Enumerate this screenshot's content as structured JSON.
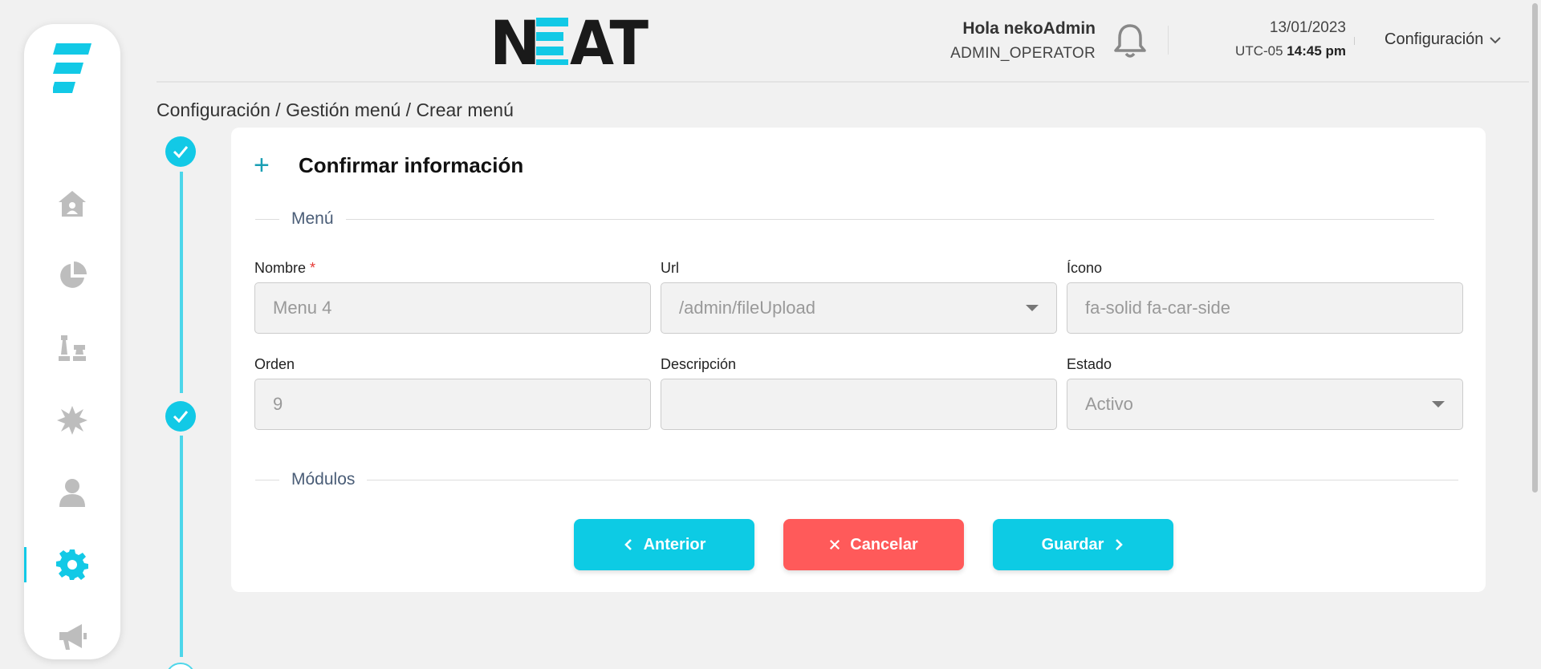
{
  "header": {
    "brand": "NEAT",
    "greeting": "Hola nekoAdmin",
    "role": "ADMIN_OPERATOR",
    "date": "13/01/2023",
    "tz": "UTC-05",
    "time": "14:45 pm",
    "config_label": "Configuración"
  },
  "sidebar": {
    "items": [
      {
        "icon": "home-icon"
      },
      {
        "icon": "pie-chart-icon"
      },
      {
        "icon": "chess-icon"
      },
      {
        "icon": "burst-icon"
      },
      {
        "icon": "user-icon"
      },
      {
        "icon": "gear-icon",
        "active": true
      },
      {
        "icon": "megaphone-icon"
      }
    ]
  },
  "breadcrumb": "Configuración / Gestión menú / Crear menú",
  "card": {
    "title": "Confirmar información",
    "section_menu": "Menú",
    "section_modules": "Módulos",
    "fields": {
      "nombre": {
        "label": "Nombre",
        "required_mark": "*",
        "value": "Menu 4"
      },
      "url": {
        "label": "Url",
        "value": "/admin/fileUpload"
      },
      "icono": {
        "label": "Ícono",
        "value": "fa-solid fa-car-side"
      },
      "orden": {
        "label": "Orden",
        "value": "9"
      },
      "descripcion": {
        "label": "Descripción",
        "value": ""
      },
      "estado": {
        "label": "Estado",
        "value": "Activo"
      }
    },
    "buttons": {
      "anterior": "Anterior",
      "cancelar": "Cancelar",
      "guardar": "Guardar"
    }
  },
  "colors": {
    "accent": "#12c9e6",
    "danger": "#ff5a5a",
    "background": "#f1f1f1"
  }
}
